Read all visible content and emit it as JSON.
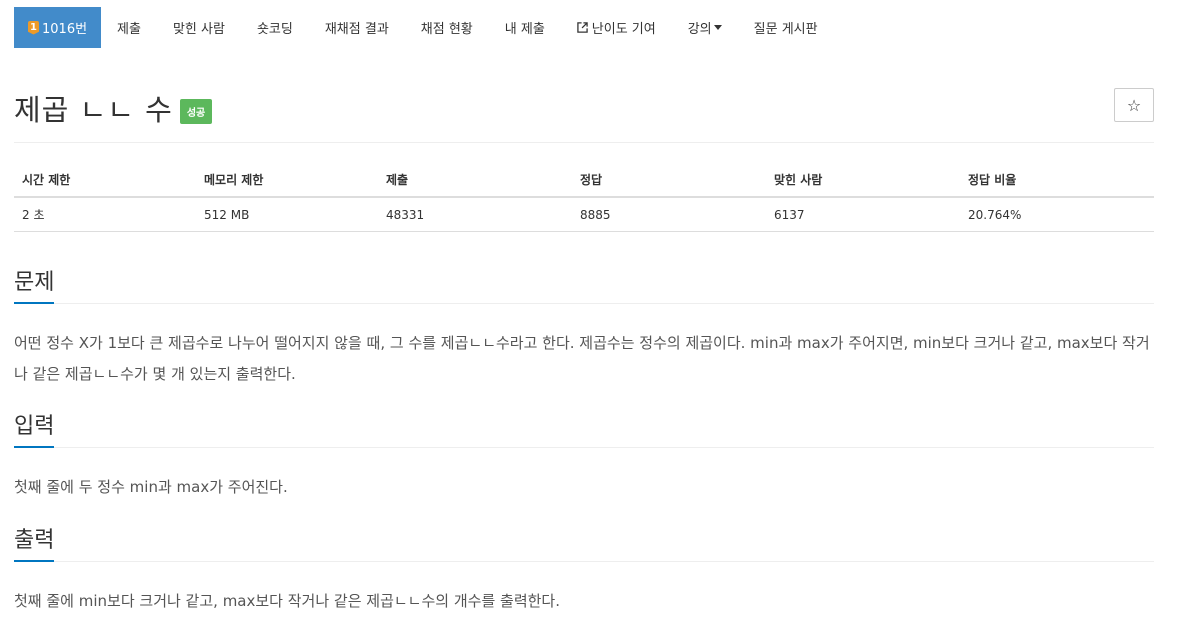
{
  "nav": {
    "problem_tier": "1",
    "problem_number": "1016번",
    "items": [
      "제출",
      "맞힌 사람",
      "숏코딩",
      "재채점 결과",
      "채점 현황",
      "내 제출",
      "난이도 기여",
      "강의",
      "질문 게시판"
    ]
  },
  "problem": {
    "title": "제곱 ㄴㄴ 수",
    "status_badge": "성공",
    "star_icon": "☆"
  },
  "info_table": {
    "headers": [
      "시간 제한",
      "메모리 제한",
      "제출",
      "정답",
      "맞힌 사람",
      "정답 비율"
    ],
    "values": [
      "2 초",
      "512 MB",
      "48331",
      "8885",
      "6137",
      "20.764%"
    ]
  },
  "sections": {
    "description": {
      "heading": "문제",
      "body": "어떤 정수 X가 1보다 큰 제곱수로 나누어 떨어지지 않을 때, 그 수를 제곱ㄴㄴ수라고 한다. 제곱수는 정수의 제곱이다. min과 max가 주어지면, min보다 크거나 같고, max보다 작거나 같은 제곱ㄴㄴ수가 몇 개 있는지 출력한다."
    },
    "input": {
      "heading": "입력",
      "body": "첫째 줄에 두 정수 min과 max가 주어진다."
    },
    "output": {
      "heading": "출력",
      "body": "첫째 줄에 min보다 크거나 같고, max보다 작거나 같은 제곱ㄴㄴ수의 개수를 출력한다."
    }
  },
  "colors": {
    "accent": "#428bca",
    "success": "#5cb85c",
    "heading_underline": "#0076c0",
    "tier_badge": "#ec9a29"
  }
}
